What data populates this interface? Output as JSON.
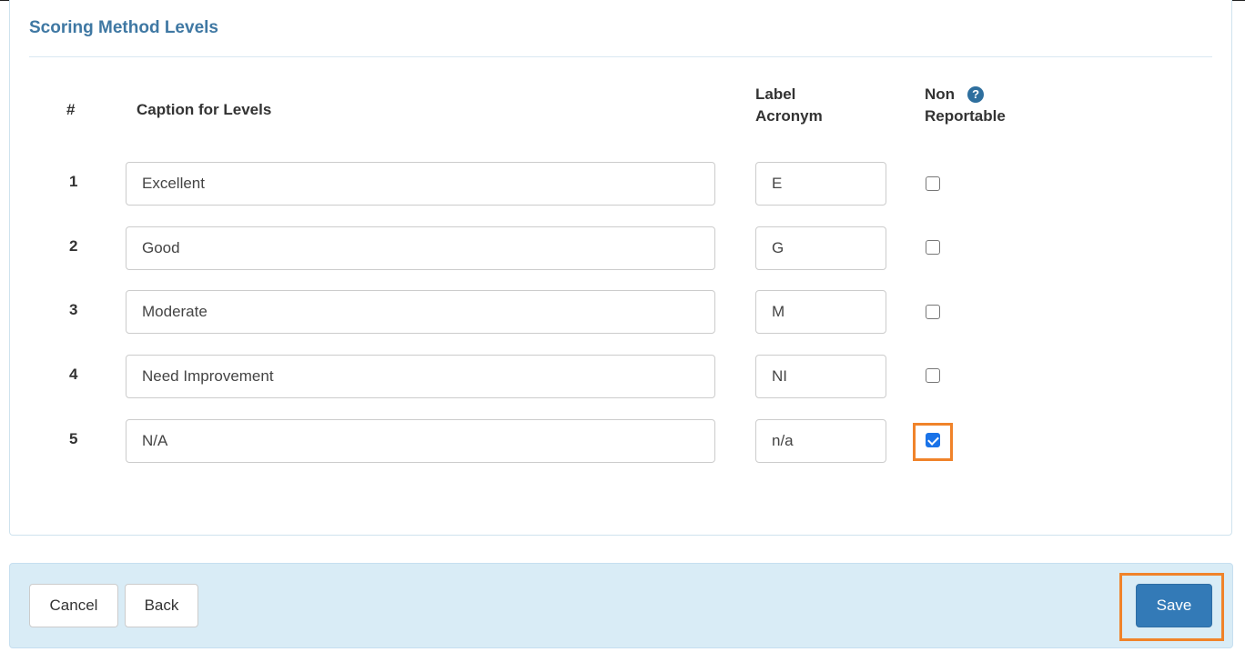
{
  "section": {
    "title": "Scoring Method Levels"
  },
  "table": {
    "headers": {
      "number": "#",
      "caption": "Caption for Levels",
      "acronym_line1": "Label",
      "acronym_line2": "Acronym",
      "non_reportable_line1": "Non",
      "non_reportable_line2": "Reportable",
      "help_icon": "question-circle-icon"
    },
    "rows": [
      {
        "number": "1",
        "caption": "Excellent",
        "acronym": "E",
        "non_reportable": false
      },
      {
        "number": "2",
        "caption": "Good",
        "acronym": "G",
        "non_reportable": false
      },
      {
        "number": "3",
        "caption": "Moderate",
        "acronym": "M",
        "non_reportable": false
      },
      {
        "number": "4",
        "caption": "Need Improvement",
        "acronym": "NI",
        "non_reportable": false
      },
      {
        "number": "5",
        "caption": "N/A",
        "acronym": "n/a",
        "non_reportable": true
      }
    ]
  },
  "footer": {
    "cancel_label": "Cancel",
    "back_label": "Back",
    "save_label": "Save"
  },
  "colors": {
    "title": "#3f78a3",
    "primary_button": "#337ab7",
    "footer_bg": "#d9ecf6",
    "highlight": "#f0832a"
  }
}
